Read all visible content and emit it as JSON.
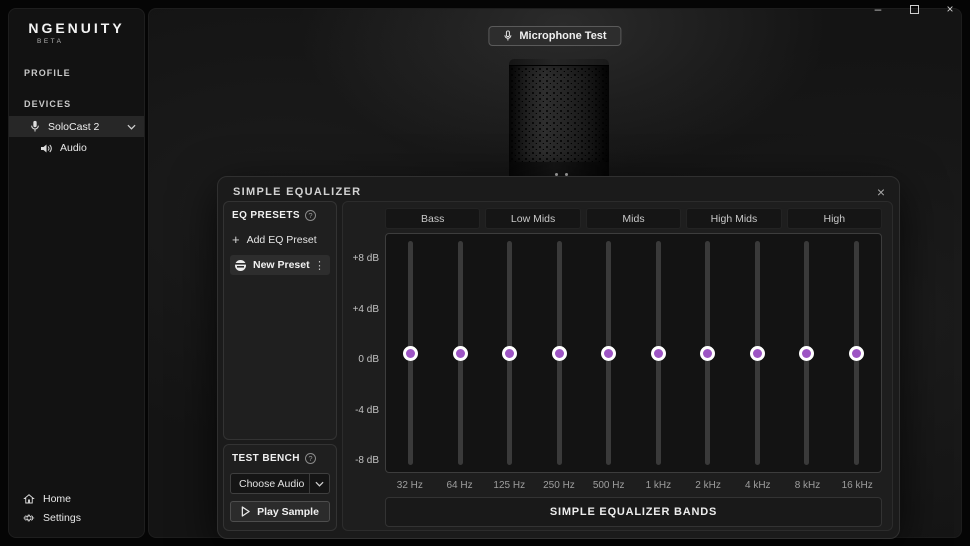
{
  "window_controls": {
    "minimize_glyph": "–",
    "close_glyph": "×"
  },
  "sidebar": {
    "logo": "NGENUITY",
    "logo_badge": "BETA",
    "profile_header": "PROFILE",
    "devices_header": "DEVICES",
    "device": {
      "name": "SoloCast 2"
    },
    "device_sub": {
      "name": "Audio"
    },
    "footer": {
      "home": "Home",
      "settings": "Settings"
    }
  },
  "toolbar": {
    "mic_test": "Microphone Test"
  },
  "equalizer": {
    "title": "SIMPLE EQUALIZER",
    "close_glyph": "×",
    "presets": {
      "header": "EQ PRESETS",
      "help_glyph": "?",
      "add_label": "Add EQ Preset",
      "add_glyph": "+",
      "selected_preset": "New Preset",
      "kebab_glyph": "⋮"
    },
    "test_bench": {
      "header": "TEST BENCH",
      "help_glyph": "?",
      "audio_select_value": "Choose Audio",
      "play_label": "Play Sample"
    },
    "bands": [
      "Bass",
      "Low Mids",
      "Mids",
      "High Mids",
      "High"
    ],
    "footer_label": "SIMPLE EQUALIZER BANDS",
    "chart_data": {
      "type": "slider-bank",
      "x_labels": [
        "32 Hz",
        "64 Hz",
        "125 Hz",
        "250 Hz",
        "500 Hz",
        "1 kHz",
        "2 kHz",
        "4 kHz",
        "8 kHz",
        "16 kHz"
      ],
      "values_db": [
        0,
        0,
        0,
        0,
        0,
        0,
        0,
        0,
        0,
        0
      ],
      "y_tick_labels": [
        "+8 dB",
        "+4 dB",
        "0 dB",
        "-4 dB",
        "-8 dB"
      ],
      "db_range": [
        -10,
        10
      ]
    }
  },
  "colors": {
    "accent_purple": "#9d55c4",
    "knob_ring": "#ffffff"
  }
}
